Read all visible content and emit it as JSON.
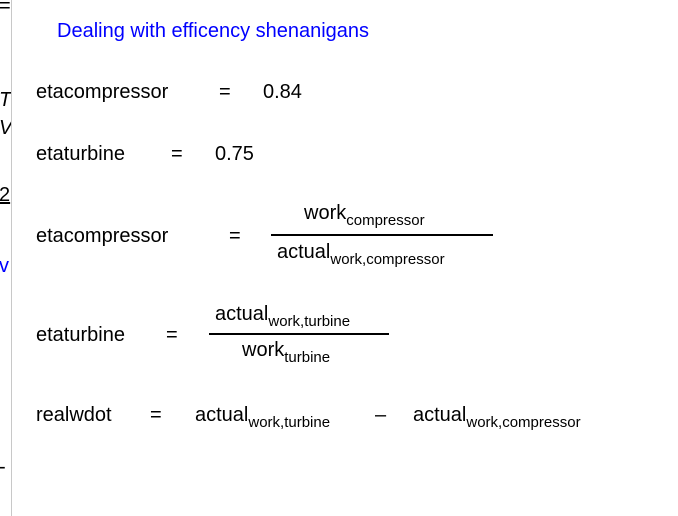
{
  "left_fragments": {
    "f1": "=",
    "f2": "T",
    "f3": "V",
    "f4": "2",
    "f5": "v",
    "f6": "-"
  },
  "heading": "Dealing with efficency shenanigans",
  "eq1": {
    "lhs": "etacompressor",
    "op": "=",
    "rhs": "0.84"
  },
  "eq2": {
    "lhs": "etaturbine",
    "op": "=",
    "rhs": "0.75"
  },
  "eq3": {
    "lhs": "etacompressor",
    "op": "=",
    "num_base": "work",
    "num_sub": "compressor",
    "den_base": "actual",
    "den_sub": "work,compressor"
  },
  "eq4": {
    "lhs": "etaturbine",
    "op": "=",
    "num_base": "actual",
    "num_sub": "work,turbine",
    "den_base": "work",
    "den_sub": "turbine"
  },
  "eq5": {
    "lhs": "realwdot",
    "op": "=",
    "t1_base": "actual",
    "t1_sub": "work,turbine",
    "minus": "–",
    "t2_base": "actual",
    "t2_sub": "work,compressor"
  }
}
